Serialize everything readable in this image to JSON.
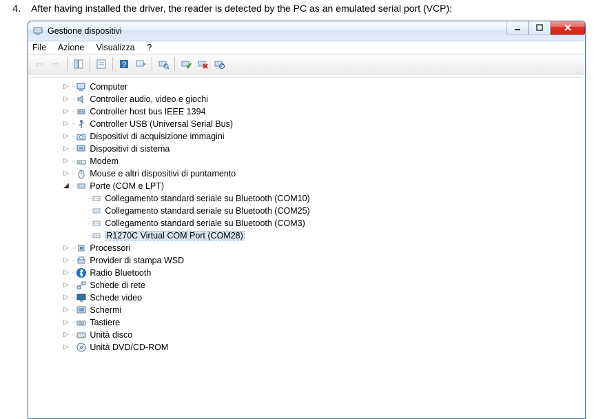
{
  "doc": {
    "number": "4.",
    "text": "After having installed the driver, the reader is detected by the PC as an emulated serial port (VCP):"
  },
  "window": {
    "title": "Gestione dispositivi",
    "menu": {
      "file": "File",
      "action": "Azione",
      "view": "Visualizza",
      "help": "?"
    },
    "controls": {
      "min": "—",
      "max": "▢",
      "close": "X"
    }
  },
  "tree": [
    {
      "level": 1,
      "exp": "closed",
      "icon": "computer",
      "label": "Computer"
    },
    {
      "level": 1,
      "exp": "closed",
      "icon": "sound",
      "label": "Controller audio, video e giochi"
    },
    {
      "level": 1,
      "exp": "closed",
      "icon": "ieee",
      "label": "Controller host bus IEEE 1394"
    },
    {
      "level": 1,
      "exp": "closed",
      "icon": "usb",
      "label": "Controller USB (Universal Serial Bus)"
    },
    {
      "level": 1,
      "exp": "closed",
      "icon": "imaging",
      "label": "Dispositivi di acquisizione immagini"
    },
    {
      "level": 1,
      "exp": "closed",
      "icon": "sysdev",
      "label": "Dispositivi di sistema"
    },
    {
      "level": 1,
      "exp": "closed",
      "icon": "modem",
      "label": "Modem"
    },
    {
      "level": 1,
      "exp": "closed",
      "icon": "mouse",
      "label": "Mouse e altri dispositivi di puntamento"
    },
    {
      "level": 1,
      "exp": "open",
      "icon": "ports",
      "label": "Porte (COM e LPT)"
    },
    {
      "level": 2,
      "exp": "none",
      "icon": "port",
      "label": "Collegamento standard seriale su Bluetooth (COM10)"
    },
    {
      "level": 2,
      "exp": "none",
      "icon": "port",
      "label": "Collegamento standard seriale su Bluetooth (COM25)"
    },
    {
      "level": 2,
      "exp": "none",
      "icon": "port",
      "label": "Collegamento standard seriale su Bluetooth (COM3)"
    },
    {
      "level": 2,
      "exp": "none",
      "icon": "port",
      "label": "R1270C Virtual COM Port  (COM28)",
      "selected": true
    },
    {
      "level": 1,
      "exp": "closed",
      "icon": "cpu",
      "label": "Processori"
    },
    {
      "level": 1,
      "exp": "closed",
      "icon": "printer",
      "label": "Provider di stampa WSD"
    },
    {
      "level": 1,
      "exp": "closed",
      "icon": "bluetooth",
      "label": "Radio Bluetooth"
    },
    {
      "level": 1,
      "exp": "closed",
      "icon": "network",
      "label": "Schede di rete"
    },
    {
      "level": 1,
      "exp": "closed",
      "icon": "display",
      "label": "Schede video"
    },
    {
      "level": 1,
      "exp": "closed",
      "icon": "monitor",
      "label": "Schermi"
    },
    {
      "level": 1,
      "exp": "closed",
      "icon": "keyboard",
      "label": "Tastiere"
    },
    {
      "level": 1,
      "exp": "closed",
      "icon": "disk",
      "label": "Unità disco"
    },
    {
      "level": 1,
      "exp": "closed",
      "icon": "dvd",
      "label": "Unità DVD/CD-ROM"
    }
  ]
}
